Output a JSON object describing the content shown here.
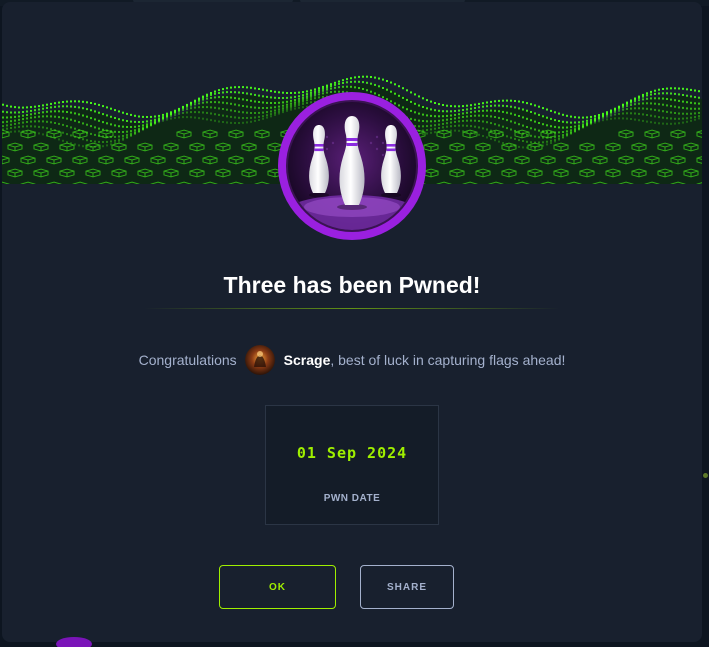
{
  "modal": {
    "title": "Three has been Pwned!",
    "congrats_prefix": "Congratulations",
    "username": "Scrage",
    "congrats_suffix": ", best of luck in capturing flags ahead!",
    "pwn_date": "01 Sep 2024",
    "pwn_date_label": "PWN DATE",
    "ok_label": "OK",
    "share_label": "SHARE"
  },
  "icons": {
    "badge": "bowling-pins-icon",
    "avatar": "user-avatar"
  },
  "colors": {
    "accent_green": "#9fef00",
    "badge_ring": "#9a20e0",
    "modal_bg": "#18202e",
    "text_muted": "#a4b1cd"
  }
}
